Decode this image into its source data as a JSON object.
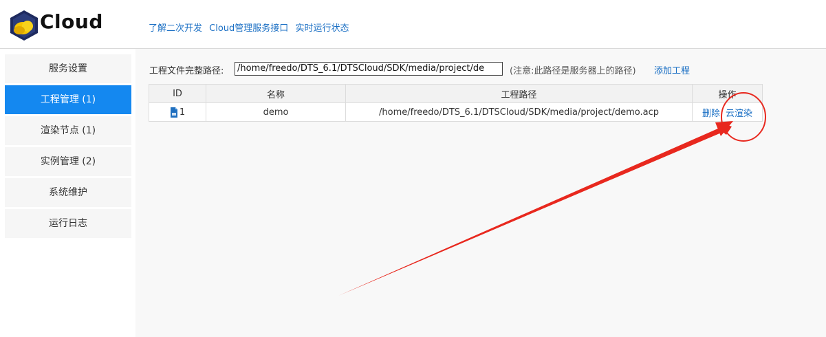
{
  "header": {
    "brand": "Cloud",
    "nav": [
      "了解二次开发",
      "Cloud管理服务接口",
      "实时运行状态"
    ]
  },
  "sidebar": {
    "items": [
      {
        "label": "服务设置",
        "active": false
      },
      {
        "label": "工程管理 (1)",
        "active": true
      },
      {
        "label": "渲染节点 (1)",
        "active": false
      },
      {
        "label": "实例管理 (2)",
        "active": false
      },
      {
        "label": "系统维护",
        "active": false
      },
      {
        "label": "运行日志",
        "active": false
      }
    ]
  },
  "project": {
    "path_label": "工程文件完整路径:",
    "path_value": "/home/freedo/DTS_6.1/DTSCloud/SDK/media/project/de",
    "note": "(注意:此路径是服务器上的路径)",
    "add_label": "添加工程"
  },
  "table": {
    "headers": [
      "ID",
      "名称",
      "工程路径",
      "操作"
    ],
    "rows": [
      {
        "id": "1",
        "name": "demo",
        "path": "/home/freedo/DTS_6.1/DTSCloud/SDK/media/project/demo.acp",
        "ops": [
          "删除",
          "云渲染"
        ]
      }
    ]
  },
  "colors": {
    "accent": "#1488f0",
    "link": "#1a6fc4",
    "annotation": "#e8281e"
  }
}
